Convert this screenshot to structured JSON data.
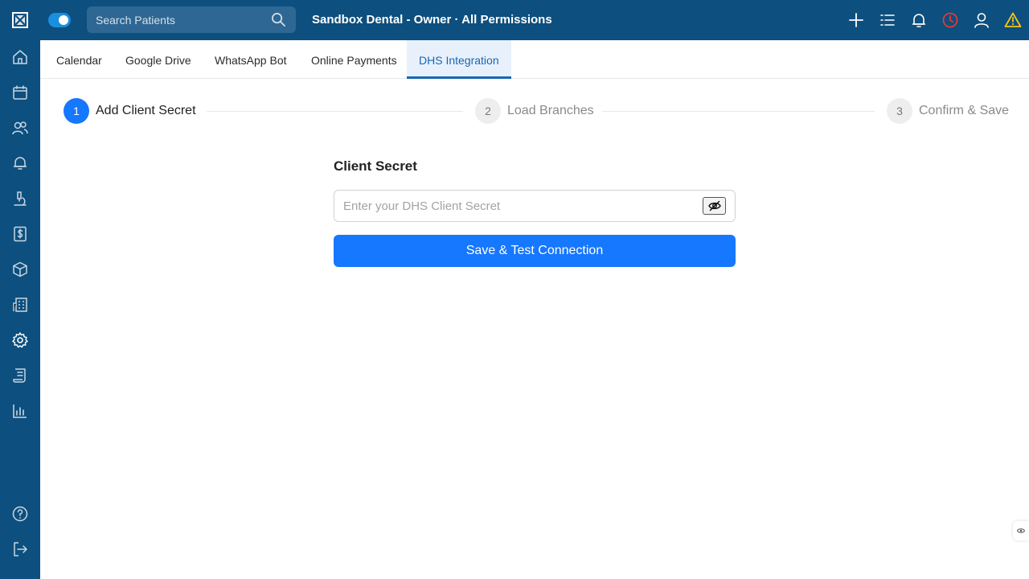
{
  "header": {
    "search_placeholder": "Search Patients",
    "clinic_title": "Sandbox Dental - Owner · All Permissions",
    "icons": [
      "plus-icon",
      "list-icon",
      "bell-icon",
      "clock-icon",
      "user-icon",
      "warning-icon"
    ]
  },
  "sidebar": {
    "icons": [
      "home-icon",
      "calendar-icon",
      "users-icon",
      "bell-icon",
      "microscope-icon",
      "dollar-icon",
      "box-icon",
      "building-icon",
      "gear-icon",
      "scroll-icon",
      "bar-chart-icon",
      "help-icon",
      "logout-icon"
    ]
  },
  "tabs": [
    {
      "label": "Calendar"
    },
    {
      "label": "Google Drive"
    },
    {
      "label": "WhatsApp Bot"
    },
    {
      "label": "Online Payments"
    },
    {
      "label": "DHS Integration",
      "active": true
    }
  ],
  "steps": [
    {
      "number": "1",
      "label": "Add Client Secret",
      "status": "active"
    },
    {
      "number": "2",
      "label": "Load Branches",
      "status": "inactive"
    },
    {
      "number": "3",
      "label": "Confirm & Save",
      "status": "inactive"
    }
  ],
  "form": {
    "label": "Client Secret",
    "placeholder": "Enter your DHS Client Secret",
    "value": "",
    "button_label": "Save & Test Connection"
  },
  "colors": {
    "brand": "#0d4f7e",
    "primary": "#1677ff",
    "active_tab": "#1667b4",
    "warning": "#f5c518",
    "clock_alert": "#e53935"
  }
}
